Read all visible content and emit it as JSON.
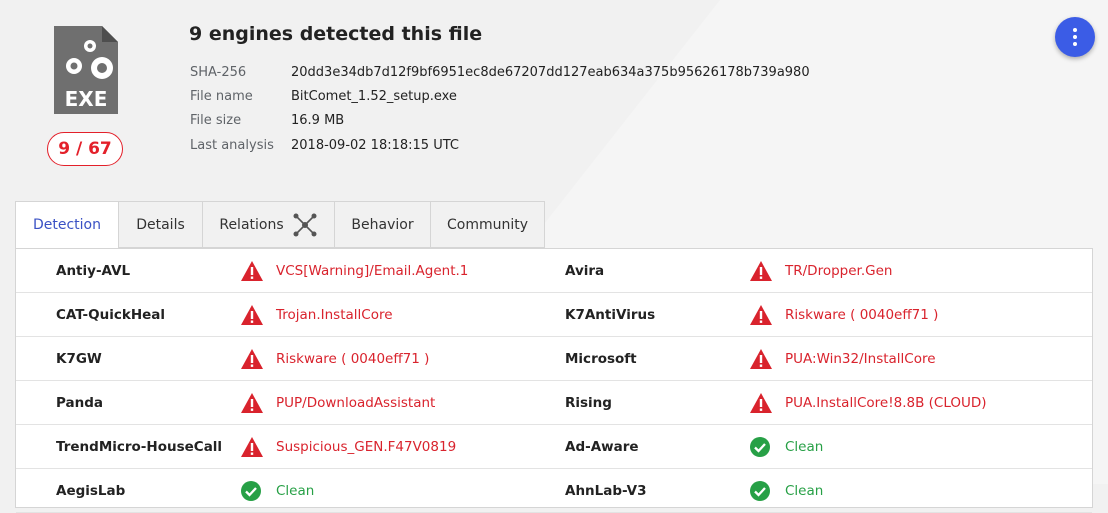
{
  "file": {
    "type_label": "EXE",
    "score": "9 / 67",
    "headline": "9 engines detected this file",
    "meta": [
      {
        "key": "SHA-256",
        "value": "20dd3e34db7d12f9bf6951ec8de67207dd127eab634a375b95626178b739a980"
      },
      {
        "key": "File name",
        "value": "BitComet_1.52_setup.exe"
      },
      {
        "key": "File size",
        "value": "16.9 MB"
      },
      {
        "key": "Last analysis",
        "value": "2018-09-02 18:18:15 UTC"
      }
    ]
  },
  "tabs": [
    {
      "label": "Detection",
      "active": true
    },
    {
      "label": "Details"
    },
    {
      "label": "Relations",
      "icon": "graph-icon"
    },
    {
      "label": "Behavior"
    },
    {
      "label": "Community"
    }
  ],
  "detections": [
    {
      "left": {
        "engine": "Antiy-AVL",
        "result": "VCS[Warning]/Email.Agent.1",
        "status": "malicious"
      },
      "right": {
        "engine": "Avira",
        "result": "TR/Dropper.Gen",
        "status": "malicious"
      }
    },
    {
      "left": {
        "engine": "CAT-QuickHeal",
        "result": "Trojan.InstallCore",
        "status": "malicious"
      },
      "right": {
        "engine": "K7AntiVirus",
        "result": "Riskware ( 0040eff71 )",
        "status": "malicious"
      }
    },
    {
      "left": {
        "engine": "K7GW",
        "result": "Riskware ( 0040eff71 )",
        "status": "malicious"
      },
      "right": {
        "engine": "Microsoft",
        "result": "PUA:Win32/InstallCore",
        "status": "malicious"
      }
    },
    {
      "left": {
        "engine": "Panda",
        "result": "PUP/DownloadAssistant",
        "status": "malicious"
      },
      "right": {
        "engine": "Rising",
        "result": "PUA.InstallCore!8.8B (CLOUD)",
        "status": "malicious"
      }
    },
    {
      "left": {
        "engine": "TrendMicro-HouseCall",
        "result": "Suspicious_GEN.F47V0819",
        "status": "malicious"
      },
      "right": {
        "engine": "Ad-Aware",
        "result": "Clean",
        "status": "clean"
      }
    },
    {
      "left": {
        "engine": "AegisLab",
        "result": "Clean",
        "status": "clean"
      },
      "right": {
        "engine": "AhnLab-V3",
        "result": "Clean",
        "status": "clean"
      }
    }
  ],
  "colors": {
    "accent": "#3b5ce6",
    "malicious": "#d9232d",
    "clean": "#27a046",
    "score": "#e3202a"
  }
}
